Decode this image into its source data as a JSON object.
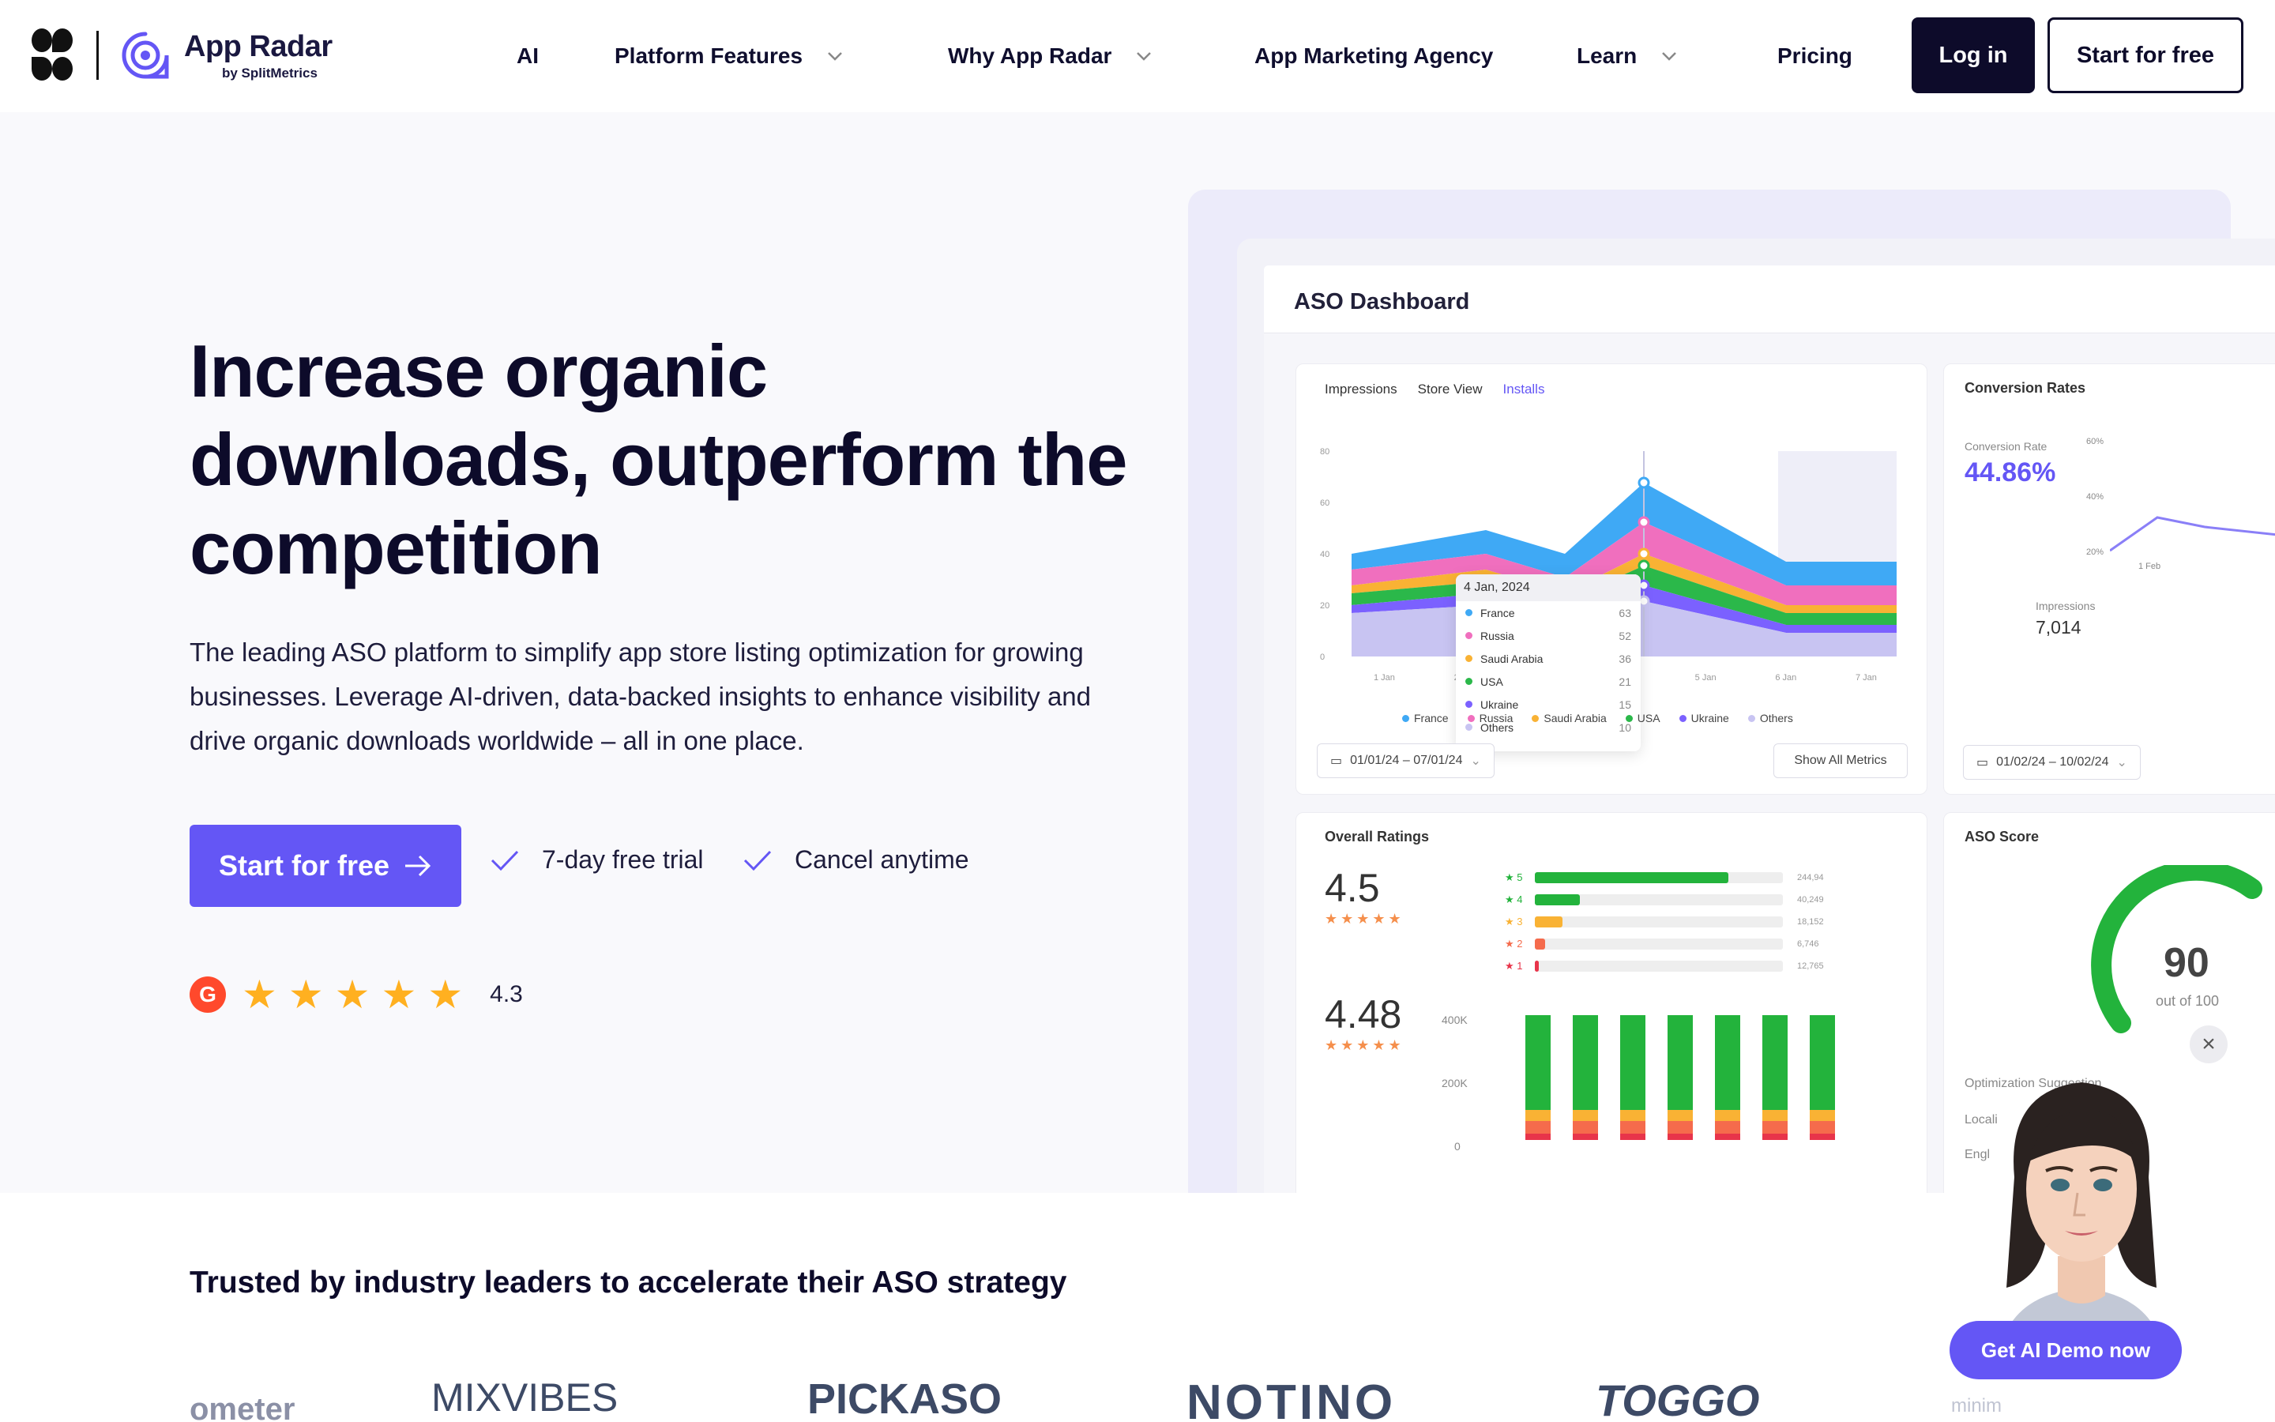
{
  "header": {
    "brand_name": "App Radar",
    "brand_by": "by SplitMetrics",
    "nav": [
      {
        "label": "AI",
        "has_dropdown": false
      },
      {
        "label": "Platform Features",
        "has_dropdown": true
      },
      {
        "label": "Why App Radar",
        "has_dropdown": true
      },
      {
        "label": "App Marketing Agency",
        "has_dropdown": false
      },
      {
        "label": "Learn",
        "has_dropdown": true
      },
      {
        "label": "Pricing",
        "has_dropdown": false
      }
    ],
    "login_label": "Log in",
    "start_label": "Start for free"
  },
  "hero": {
    "title": "Increase organic downloads, outperform the competition",
    "subtitle": "The leading ASO platform to simplify app store listing optimization for growing businesses. Leverage AI-driven, data-backed insights to enhance visibility and drive organic downloads worldwide – all in one place.",
    "cta_label": "Start for free",
    "features": [
      "7-day free trial",
      "Cancel anytime"
    ],
    "rating_value": "4.3",
    "rating_stars": 5
  },
  "dashboard": {
    "title": "ASO Dashboard",
    "tabs": [
      "Impressions",
      "Store View",
      "Installs"
    ],
    "active_tab": "Installs",
    "y_ticks": [
      "80",
      "60",
      "40",
      "20",
      "0"
    ],
    "x_ticks": [
      "1 Jan",
      "2 Jan",
      "3 Jan",
      "4 Jan",
      "5 Jan",
      "6 Jan",
      "7 Jan"
    ],
    "tooltip_date": "4 Jan, 2024",
    "tooltip_rows": [
      {
        "name": "France",
        "value": "63"
      },
      {
        "name": "Russia",
        "value": "52"
      },
      {
        "name": "Saudi Arabia",
        "value": "36"
      },
      {
        "name": "USA",
        "value": "21"
      },
      {
        "name": "Ukraine",
        "value": "15"
      },
      {
        "name": "Others",
        "value": "10"
      }
    ],
    "legend": [
      "France",
      "Russia",
      "Saudi Arabia",
      "USA",
      "Ukraine",
      "Others"
    ],
    "date_range": "01/01/24 – 07/01/24",
    "show_all": "Show All Metrics",
    "conversion": {
      "title": "Conversion Rates",
      "label": "Conversion Rate",
      "value": "44.86%",
      "ticks": [
        "60%",
        "40%",
        "20%"
      ],
      "x_tick": "1 Feb",
      "impressions_label": "Impressions",
      "impressions_value": "7,014",
      "date_range": "01/02/24 – 10/02/24"
    },
    "ratings": {
      "title": "Overall Ratings",
      "score1": "4.5",
      "score2": "4.48",
      "bars": [
        {
          "star": "5",
          "count": "244,94",
          "fill": 0.78
        },
        {
          "star": "4",
          "count": "40,249",
          "fill": 0.18
        },
        {
          "star": "3",
          "count": "18,152",
          "fill": 0.11
        },
        {
          "star": "2",
          "count": "6,746",
          "fill": 0.04
        },
        {
          "star": "1",
          "count": "12,765",
          "fill": 0.015
        }
      ],
      "y_ticks": [
        "400K",
        "200K",
        "0"
      ],
      "legend": [
        "5 star",
        "4 stars",
        "3 stars",
        "2 stars",
        "1 star"
      ]
    },
    "aso_score": {
      "title": "ASO Score",
      "value": "90",
      "of": "out of 100",
      "suggestion": "Optimization Suggestion",
      "rows": [
        "Locali",
        "Engl"
      ]
    }
  },
  "colors": {
    "accent": "#6456f5",
    "dark": "#0d0b2a",
    "france": "#3fa9f5",
    "russia": "#f06fbe",
    "saudi": "#f9b234",
    "usa": "#2bb84a",
    "ukraine": "#7b61ff",
    "others": "#c8c4f2"
  },
  "trusted": {
    "title": "Trusted by industry leaders to accelerate their ASO strategy",
    "logos": [
      "ometer",
      "MIXVIBES",
      "PICKASO",
      "NOTINO",
      "TOGGO",
      "minim"
    ]
  },
  "chat": {
    "demo_label": "Get AI Demo now"
  }
}
